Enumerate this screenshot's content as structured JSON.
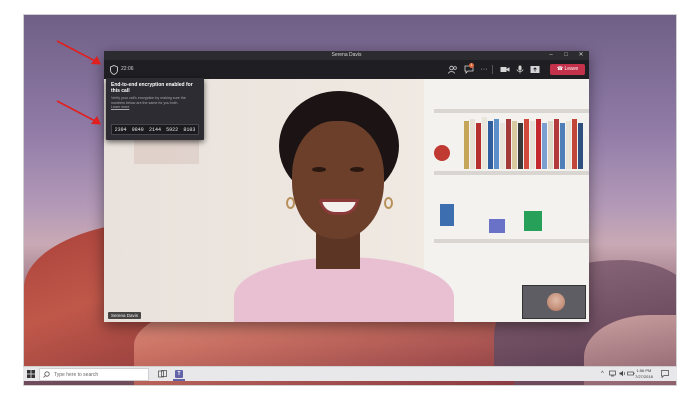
{
  "window": {
    "title": "Serena Davis",
    "minimize_glyph": "–",
    "maximize_glyph": "□",
    "close_glyph": "✕"
  },
  "toolbar": {
    "call_time": "22:06",
    "icons": [
      "shield-icon",
      "participants-icon",
      "chat-icon",
      "more-icon",
      "camera-icon",
      "microphone-icon",
      "share-icon",
      "phone-icon"
    ],
    "chat_badge": "1",
    "more_glyph": "···",
    "leave_label": "Leave"
  },
  "encryption_popup": {
    "title": "End-to-end encryption enabled for this call",
    "body": "Verify your call's encryption by making sure the numbers below are the same for you both.",
    "link": "Learn more",
    "codes": [
      "2394",
      "9849",
      "2144",
      "5922",
      "8103"
    ]
  },
  "video": {
    "participant_name": "Serena Davis"
  },
  "taskbar": {
    "search_placeholder": "Type here to search",
    "time": "1:56 PM",
    "date": "7/27/2018"
  },
  "colors": {
    "leave": "#c4314b",
    "teams": "#6264a7",
    "arrow": "#e0201e",
    "popup_bg": "#2d2c33"
  }
}
